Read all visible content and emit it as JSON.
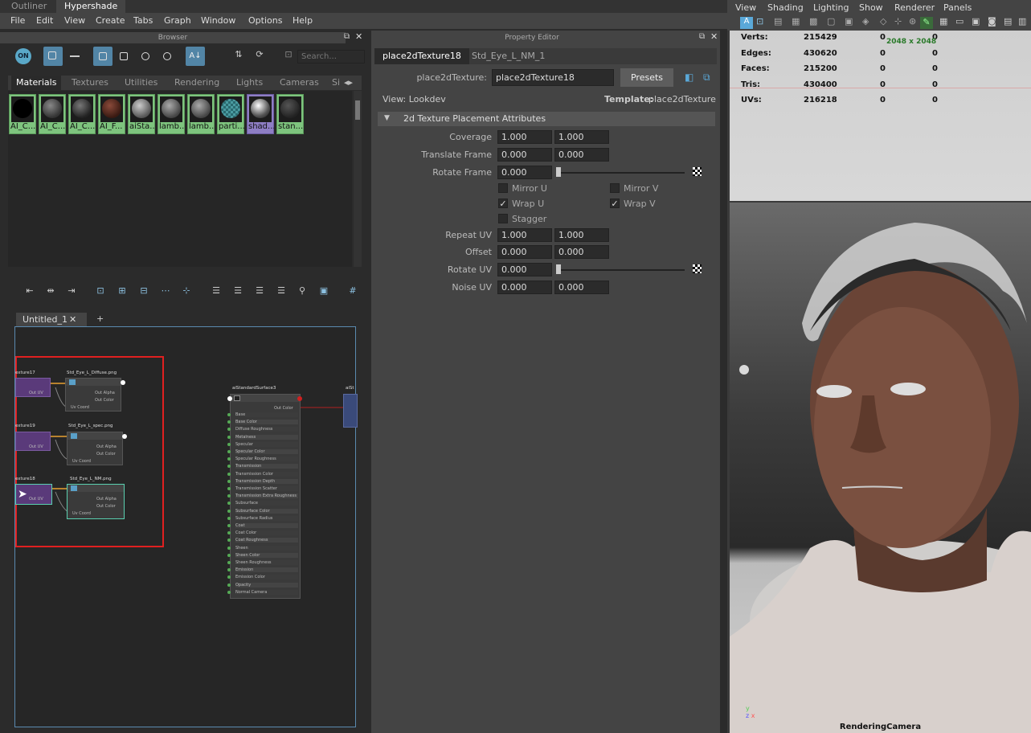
{
  "top_tabs": [
    "Outliner",
    "Hypershade"
  ],
  "menu": [
    "File",
    "Edit",
    "View",
    "Create",
    "Tabs",
    "Graph",
    "Window",
    "Options",
    "Help"
  ],
  "browser": {
    "title": "Browser",
    "search_placeholder": "Search...",
    "on_label": "ON",
    "tabs": [
      "Materials",
      "Textures",
      "Utilities",
      "Rendering",
      "Lights",
      "Cameras",
      "Si"
    ],
    "swatches": [
      "AI_C...",
      "AI_C...",
      "AI_C...",
      "AI_F...",
      "aiSta...",
      "lamb...",
      "lamb...",
      "parti...",
      "shad...",
      "stan..."
    ]
  },
  "graph": {
    "tab_label": "Untitled_1",
    "add_tab": "+",
    "nodes": {
      "tex17": "exture17",
      "file_diffuse": "Std_Eye_L_Diffuse.png",
      "tex19": "exture19",
      "file_spec": "Std_Eye_L_spec.png",
      "tex18": "exture18",
      "file_nm": "Std_Eye_L_NM.png",
      "surface": "aiStandardSurface3",
      "sg": "aiSt",
      "out_uv": "Out UV",
      "out_alpha": "Out Alpha",
      "out_color": "Out Color",
      "uv_coord": "Uv Coord",
      "surface_attrs": [
        "Base",
        "Base Color",
        "Diffuse Roughness",
        "Metalness",
        "Specular",
        "Specular Color",
        "Specular Roughness",
        "Transmission",
        "Transmission Color",
        "Transmission Depth",
        "Transmission Scatter",
        "Transmission Extra Roughness",
        "Subsurface",
        "Subsurface Color",
        "Subsurface Radius",
        "Coat",
        "Coat Color",
        "Coat Roughness",
        "Sheen",
        "Sheen Color",
        "Sheen Roughness",
        "Emission",
        "Emission Color",
        "Opacity",
        "Normal Camera"
      ]
    }
  },
  "property_editor": {
    "title": "Property Editor",
    "tabs": [
      "place2dTexture18",
      "Std_Eye_L_NM_1"
    ],
    "node_type": "place2dTexture:",
    "node_name": "place2dTexture18",
    "presets": "Presets",
    "view": "View: Lookdev",
    "template_label": "Template:",
    "template_value": "place2dTexture",
    "section": "2d Texture Placement Attributes",
    "coverage": {
      "label": "Coverage",
      "v": [
        "1.000",
        "1.000"
      ]
    },
    "translate": {
      "label": "Translate Frame",
      "v": [
        "0.000",
        "0.000"
      ]
    },
    "rotate_frame": {
      "label": "Rotate Frame",
      "v": "0.000"
    },
    "mirror_u": "Mirror U",
    "mirror_v": "Mirror V",
    "wrap_u": "Wrap U",
    "wrap_v": "Wrap V",
    "stagger": "Stagger",
    "repeat": {
      "label": "Repeat UV",
      "v": [
        "1.000",
        "1.000"
      ]
    },
    "offset": {
      "label": "Offset",
      "v": [
        "0.000",
        "0.000"
      ]
    },
    "rotate_uv": {
      "label": "Rotate UV",
      "v": "0.000"
    },
    "noise": {
      "label": "Noise UV",
      "v": [
        "0.000",
        "0.000"
      ]
    }
  },
  "viewport": {
    "menu": [
      "View",
      "Shading",
      "Lighting",
      "Show",
      "Renderer",
      "Panels"
    ],
    "hud": [
      {
        "k": "Verts:",
        "a": "215429",
        "b": "0",
        "c": "0"
      },
      {
        "k": "Edges:",
        "a": "430620",
        "b": "0",
        "c": "0"
      },
      {
        "k": "Faces:",
        "a": "215200",
        "b": "0",
        "c": "0"
      },
      {
        "k": "Tris:",
        "a": "430400",
        "b": "0",
        "c": "0"
      },
      {
        "k": "UVs:",
        "a": "216218",
        "b": "0",
        "c": "0"
      }
    ],
    "resolution": "2048 x 2048",
    "camera": "RenderingCamera"
  }
}
